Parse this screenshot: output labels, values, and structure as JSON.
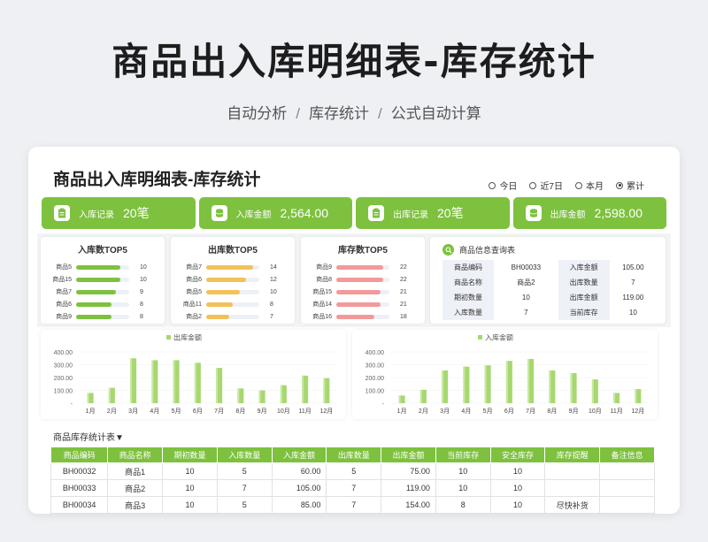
{
  "header": {
    "title": "商品出入库明细表-库存统计",
    "subtitle_parts": [
      "自动分析",
      "库存统计",
      "公式自动计算"
    ],
    "separator": "/"
  },
  "card": {
    "title": "商品出入库明细表-库存统计",
    "radios": [
      {
        "label": "今日",
        "selected": false
      },
      {
        "label": "近7日",
        "selected": false
      },
      {
        "label": "本月",
        "selected": false
      },
      {
        "label": "累计",
        "selected": true
      }
    ]
  },
  "kpis": [
    {
      "label": "入库记录",
      "value": "20笔",
      "icon": "clipboard-icon"
    },
    {
      "label": "入库金额",
      "value": "2,564.00",
      "icon": "coins-icon"
    },
    {
      "label": "出库记录",
      "value": "20笔",
      "icon": "clipboard-icon"
    },
    {
      "label": "出库金额",
      "value": "2,598.00",
      "icon": "coins-icon"
    }
  ],
  "top5": [
    {
      "title": "入库数TOP5",
      "color": "#7dc13e",
      "max": 12,
      "items": [
        {
          "name": "商品5",
          "value": 10
        },
        {
          "name": "商品15",
          "value": 10
        },
        {
          "name": "商品7",
          "value": 9
        },
        {
          "name": "商品6",
          "value": 8
        },
        {
          "name": "商品9",
          "value": 8
        }
      ]
    },
    {
      "title": "出库数TOP5",
      "color": "#f3c15a",
      "max": 16,
      "items": [
        {
          "name": "商品7",
          "value": 14
        },
        {
          "name": "商品6",
          "value": 12
        },
        {
          "name": "商品5",
          "value": 10
        },
        {
          "name": "商品11",
          "value": 8
        },
        {
          "name": "商品2",
          "value": 7
        }
      ]
    },
    {
      "title": "库存数TOP5",
      "color": "#f29a9a",
      "max": 25,
      "items": [
        {
          "name": "商品9",
          "value": 22
        },
        {
          "name": "商品8",
          "value": 22
        },
        {
          "name": "商品15",
          "value": 21
        },
        {
          "name": "商品14",
          "value": 21
        },
        {
          "name": "商品16",
          "value": 18
        }
      ]
    }
  ],
  "query": {
    "title": "商品信息查询表",
    "rows": [
      [
        "商品编码",
        "BH00033",
        "入库金额",
        "105.00"
      ],
      [
        "商品名称",
        "商品2",
        "出库数量",
        "7"
      ],
      [
        "期初数量",
        "10",
        "出库金额",
        "119.00"
      ],
      [
        "入库数量",
        "7",
        "当前库存",
        "10"
      ]
    ]
  },
  "chart_data": [
    {
      "type": "bar",
      "legend": "出库金额",
      "categories": [
        "1月",
        "2月",
        "3月",
        "4月",
        "5月",
        "6月",
        "7月",
        "8月",
        "9月",
        "10月",
        "11月",
        "12月"
      ],
      "values": [
        80,
        120,
        350,
        335,
        335,
        315,
        275,
        115,
        100,
        140,
        215,
        195
      ],
      "yticks": [
        "400.00",
        "300.00",
        "200.00",
        "100.00",
        "-"
      ],
      "ylim": [
        0,
        400
      ]
    },
    {
      "type": "bar",
      "legend": "入库金额",
      "categories": [
        "1月",
        "2月",
        "3月",
        "4月",
        "5月",
        "6月",
        "7月",
        "8月",
        "9月",
        "10月",
        "11月",
        "12月"
      ],
      "values": [
        60,
        105,
        255,
        285,
        295,
        330,
        345,
        255,
        235,
        185,
        80,
        110
      ],
      "yticks": [
        "400.00",
        "300.00",
        "200.00",
        "100.00",
        "-"
      ],
      "ylim": [
        0,
        400
      ]
    }
  ],
  "table": {
    "title": "商品库存统计表▼",
    "headers": [
      "商品编码",
      "商品名称",
      "期初数量",
      "入库数量",
      "入库金额",
      "出库数量",
      "出库金额",
      "当前库存",
      "安全库存",
      "库存提醒",
      "备注信息"
    ],
    "rows": [
      [
        "BH00032",
        "商品1",
        "10",
        "5",
        "60.00",
        "5",
        "75.00",
        "10",
        "10",
        "",
        ""
      ],
      [
        "BH00033",
        "商品2",
        "10",
        "7",
        "105.00",
        "7",
        "119.00",
        "10",
        "10",
        "",
        ""
      ],
      [
        "BH00034",
        "商品3",
        "10",
        "5",
        "85.00",
        "7",
        "154.00",
        "8",
        "10",
        "尽快补货",
        ""
      ]
    ]
  },
  "colors": {
    "accent": "#7dc13e",
    "bar_green": "#a7d86f"
  }
}
